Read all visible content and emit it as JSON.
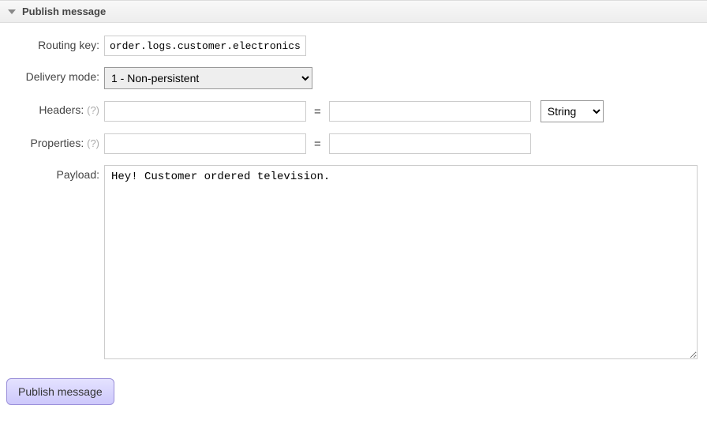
{
  "section": {
    "title": "Publish message"
  },
  "form": {
    "routing_key": {
      "label": "Routing key:",
      "value": "order.logs.customer.electronics"
    },
    "delivery_mode": {
      "label": "Delivery mode:",
      "selected": "1 - Non-persistent"
    },
    "headers": {
      "label": "Headers:",
      "help": "(?)",
      "key": "",
      "value": "",
      "type_selected": "String"
    },
    "properties": {
      "label": "Properties:",
      "help": "(?)",
      "key": "",
      "value": ""
    },
    "payload": {
      "label": "Payload:",
      "value": "Hey! Customer ordered television."
    },
    "equals": "=",
    "submit_label": "Publish message"
  }
}
